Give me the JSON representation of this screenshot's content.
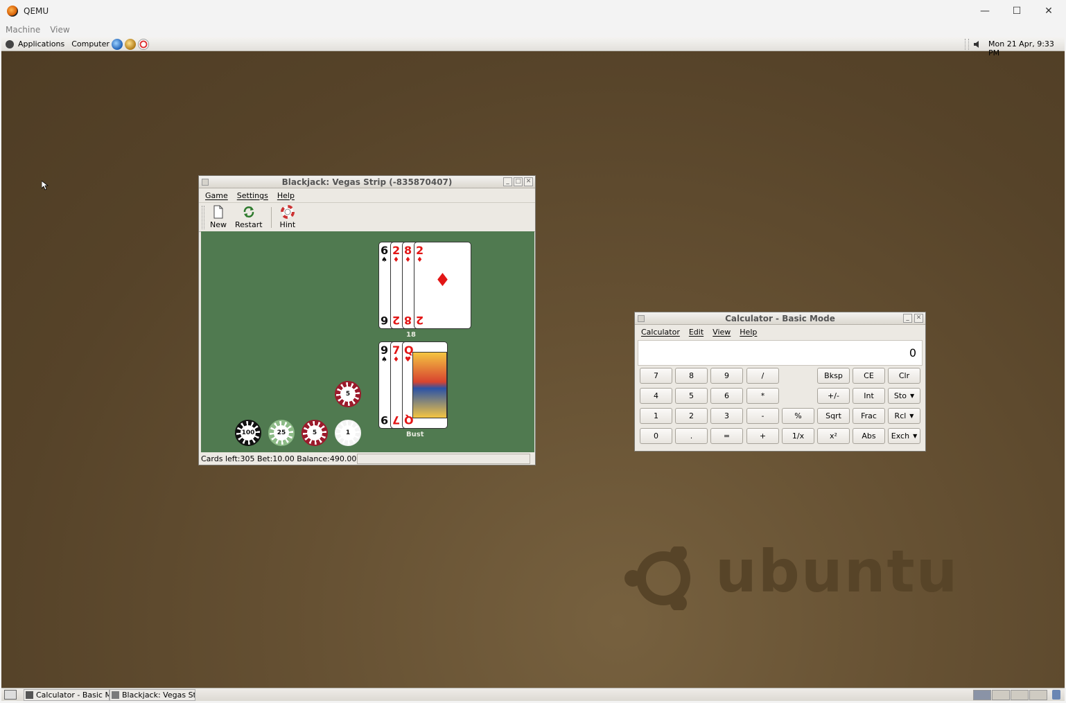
{
  "qemu": {
    "title": "QEMU",
    "menu": [
      "Machine",
      "View"
    ],
    "controls": {
      "minimize": "—",
      "maximize": "☐",
      "close": "✕"
    }
  },
  "top_panel": {
    "applications": "Applications",
    "computer": "Computer",
    "launchers": [
      "browser-icon",
      "mail-icon",
      "help-icon"
    ],
    "clock": "Mon 21 Apr,  9:33 PM"
  },
  "blackjack": {
    "title": "Blackjack: Vegas Strip (-835870407)",
    "menu": [
      "Game",
      "Settings",
      "Help"
    ],
    "toolbar": {
      "new": "New",
      "restart": "Restart",
      "hint": "Hint"
    },
    "dealer_hand": {
      "total": "18",
      "cards": [
        {
          "rank": "6",
          "suit": "♠",
          "color": "black"
        },
        {
          "rank": "2",
          "suit": "♦",
          "color": "red"
        },
        {
          "rank": "8",
          "suit": "♦",
          "color": "red"
        },
        {
          "rank": "2",
          "suit": "♦",
          "color": "red"
        }
      ]
    },
    "player_hand": {
      "total": "Bust",
      "cards": [
        {
          "rank": "9",
          "suit": "♠",
          "color": "black"
        },
        {
          "rank": "7",
          "suit": "♦",
          "color": "red"
        },
        {
          "rank": "Q",
          "suit": "♥",
          "color": "red"
        }
      ]
    },
    "chips": [
      {
        "value": "100",
        "color": "#111111"
      },
      {
        "value": "25",
        "color": "#8dbb87"
      },
      {
        "value": "5",
        "color": "#9b1a2b"
      },
      {
        "value": "1",
        "color": "#f4f4f4"
      }
    ],
    "bet_chip": {
      "value": "5",
      "color": "#9b1a2b"
    },
    "status": "Cards left:305   Bet:10.00   Balance:490.00"
  },
  "calculator": {
    "title": "Calculator - Basic Mode",
    "menu": [
      "Calculator",
      "Edit",
      "View",
      "Help"
    ],
    "display": "0",
    "buttons": {
      "r0": [
        "7",
        "8",
        "9",
        "/",
        "Bksp",
        "CE",
        "Clr"
      ],
      "r1": [
        "4",
        "5",
        "6",
        "*",
        "+/-",
        "Int",
        "Sto"
      ],
      "r2": [
        "1",
        "2",
        "3",
        "-",
        "%",
        "Sqrt",
        "Frac",
        "Rcl"
      ],
      "r3": [
        "0",
        ".",
        "=",
        "+",
        "1/x",
        "x²",
        "Abs",
        "Exch"
      ]
    }
  },
  "taskbar": {
    "items": [
      "Calculator - Basic Mo",
      "Blackjack: Vegas Stri"
    ]
  },
  "wallpaper": {
    "brand": "ubuntu"
  }
}
